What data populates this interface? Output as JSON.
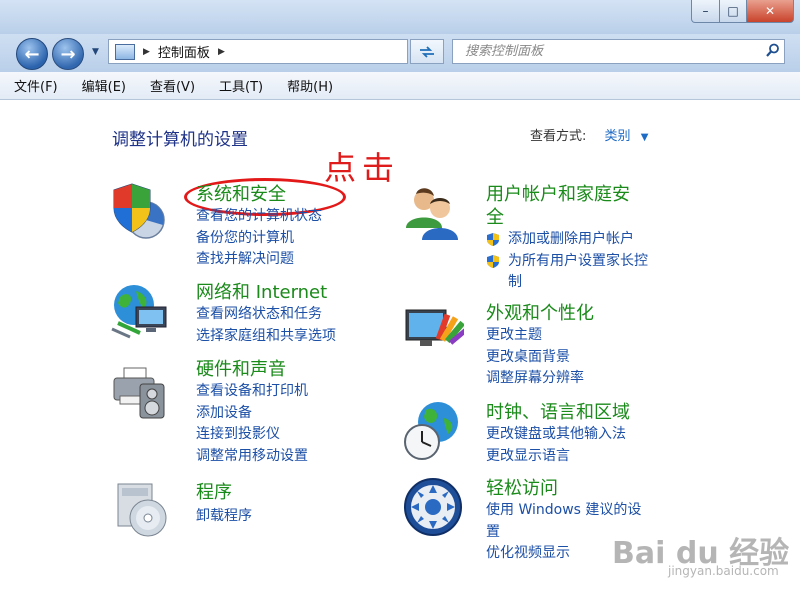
{
  "window": {
    "min_glyph": "–",
    "max_glyph": "□",
    "close_glyph": "✕"
  },
  "navbar": {
    "back_glyph": "←",
    "forward_glyph": "→",
    "address_path": "控制面板",
    "search_placeholder": "搜索控制面板",
    "icons": [
      "back-arrow-icon",
      "forward-arrow-icon",
      "control-panel-icon",
      "refresh-icon",
      "search-icon"
    ]
  },
  "menubar": {
    "items": [
      "文件(F)",
      "编辑(E)",
      "查看(V)",
      "工具(T)",
      "帮助(H)"
    ]
  },
  "main": {
    "title": "调整计算机的设置",
    "view_by_label": "查看方式:",
    "view_by_value": "类别"
  },
  "annotation": {
    "text": "点击",
    "color": "#e01b1b"
  },
  "categories": {
    "system_security": {
      "title": "系统和安全",
      "icon": "shield-pie-icon",
      "links": [
        "查看您的计算机状态",
        "备份您的计算机",
        "查找并解决问题"
      ]
    },
    "network": {
      "title": "网络和 Internet",
      "icon": "globe-network-icon",
      "links": [
        "查看网络状态和任务",
        "选择家庭组和共享选项"
      ]
    },
    "hardware": {
      "title": "硬件和声音",
      "icon": "printer-speaker-icon",
      "links": [
        "查看设备和打印机",
        "添加设备",
        "连接到投影仪",
        "调整常用移动设置"
      ]
    },
    "programs": {
      "title": "程序",
      "icon": "programs-disc-icon",
      "links": [
        "卸载程序"
      ]
    },
    "user_accounts": {
      "title_line1": "用户帐户和家庭安",
      "title_line2": "全",
      "icon": "users-icon",
      "links": [
        "添加或删除用户帐户",
        "为所有用户设置家长控",
        "制"
      ]
    },
    "appearance": {
      "title": "外观和个性化",
      "icon": "monitor-palette-icon",
      "links": [
        "更改主题",
        "更改桌面背景",
        "调整屏幕分辨率"
      ]
    },
    "clock": {
      "title": "时钟、语言和区域",
      "icon": "clock-globe-icon",
      "links": [
        "更改键盘或其他输入法",
        "更改显示语言"
      ]
    },
    "ease": {
      "title": "轻松访问",
      "icon": "ease-of-access-icon",
      "links": [
        "使用 Windows 建议的设",
        "置",
        "优化视频显示"
      ]
    }
  },
  "watermark": {
    "brand": "Bai du 经验",
    "url": "jingyan.baidu.com"
  },
  "colors": {
    "category_title": "#1a8a1a",
    "link": "#1c4fa6",
    "page_title": "#1e3287",
    "highlight_circle": "#e31818"
  }
}
